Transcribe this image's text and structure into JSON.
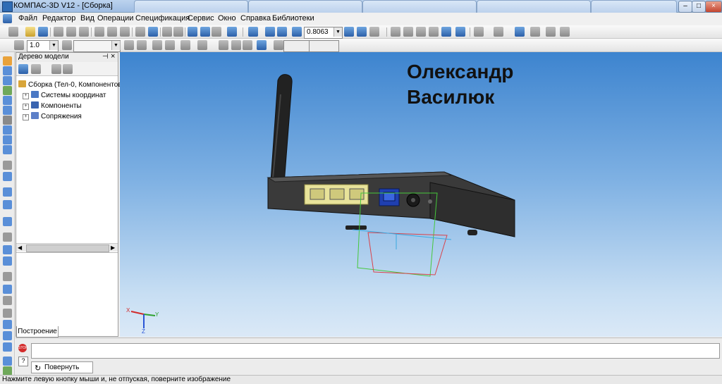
{
  "window": {
    "title": "КОМПАС-3D V12 - [Сборка]"
  },
  "menu": {
    "items": [
      "Файл",
      "Редактор",
      "Вид",
      "Операции",
      "Спецификация",
      "Сервис",
      "Окно",
      "Справка",
      "Библиотеки"
    ]
  },
  "toolbar": {
    "zoom_value": "0.8063",
    "line_step_value": "1.0"
  },
  "tree_panel": {
    "header": "Дерево модели",
    "pin_glyph": "⊣",
    "close_glyph": "×",
    "root_label": "Сборка (Тел-0, Компонентов",
    "items": [
      {
        "label": "Системы координат",
        "icon": "coordinate-systems-icon"
      },
      {
        "label": "Компоненты",
        "icon": "components-icon"
      },
      {
        "label": "Сопряжения",
        "icon": "constraints-icon"
      }
    ],
    "tab_label": "Построение"
  },
  "viewport": {
    "overlay_line1": "Олександр",
    "overlay_line2": "Василюк",
    "axis_x": "X",
    "axis_y": "Y",
    "axis_z": "Z"
  },
  "bottom": {
    "rotate_tab_label": "Повернуть",
    "stop_label": "STOP"
  },
  "status": {
    "text": "Нажмите левую кнопку мыши и, не отпуская, поверните изображение"
  },
  "colors": {
    "viewport_top": "#3d84cf",
    "viewport_bottom": "#dbe9f7",
    "router_body": "#3a3a3a",
    "lan_port_panel": "#e8e39a",
    "wan_port": "#1f3fb0",
    "selection_green": "#45c83b",
    "selection_red": "#d9434b"
  }
}
